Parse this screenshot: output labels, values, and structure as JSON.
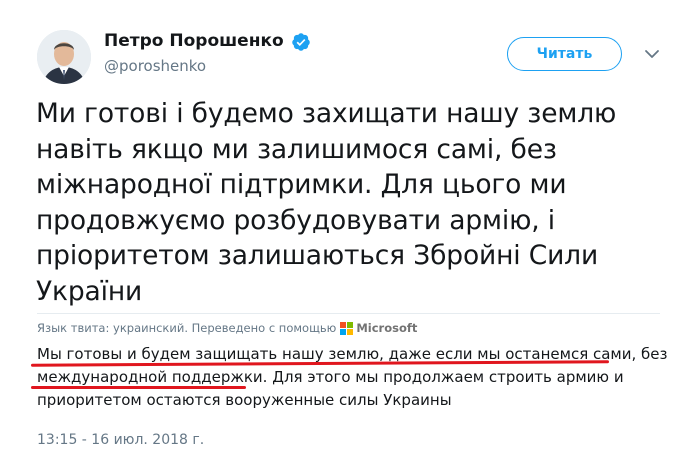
{
  "author": {
    "name": "Петро Порошенко",
    "handle": "@poroshenko",
    "verified": true
  },
  "follow_button": {
    "label": "Читать"
  },
  "icons": {
    "verified": "verified-badge-icon",
    "caret": "chevron-down-icon",
    "translator_logo": "microsoft-logo-icon"
  },
  "tweet": {
    "lines": [
      "Ми готові і будемо захищати нашу землю",
      "навіть якщо ми залишимося самі, без",
      "міжнародної підтримки. Для цього ми",
      "продовжуємо розбудовувати армію, і",
      "пріоритетом залишаються Збройні Сили",
      "України"
    ]
  },
  "translation": {
    "notice": "Язык твита: украинский. Переведено с помощью",
    "provider": "Microsoft",
    "lines": [
      "Мы готовы и будем защищать нашу землю, даже если мы останемся сами, без",
      "международной поддержки. Для этого мы продолжаем строить армию и",
      "приоритетом остаются вооруженные силы Украины"
    ],
    "highlight": {
      "line_1": "Мы готовы и будем защищать нашу землю, даже если мы останемся сами, без",
      "line_2_prefix": "международной поддержки.",
      "line_2_rest": " Для этого мы продолжаем строить армию и"
    }
  },
  "timestamp": "13:15 - 16 июл. 2018 г.",
  "colors": {
    "accent": "#1da1f2",
    "text": "#14171a",
    "muted": "#657786",
    "annotation": "#e0161e"
  }
}
